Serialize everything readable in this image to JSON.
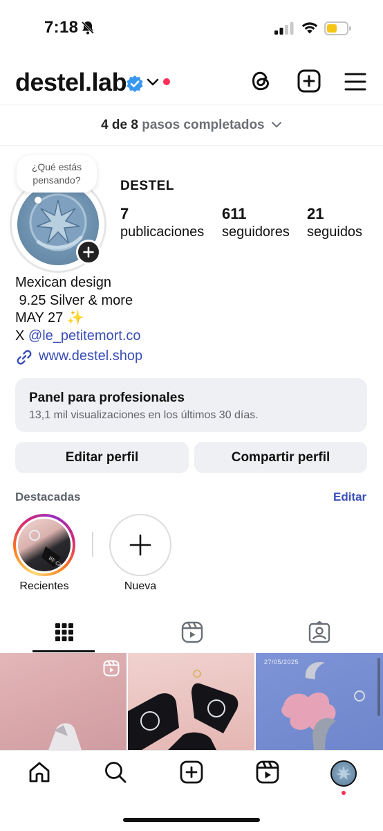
{
  "status_bar": {
    "time": "7:18",
    "battery_color": "#f5c518"
  },
  "header": {
    "username": "destel.lab",
    "icons": [
      "verified-badge-icon",
      "chevron-down-icon",
      "threads-icon",
      "create-post-icon",
      "menu-icon"
    ],
    "accent": "#3897f0"
  },
  "steps": {
    "progress": "4 de 8",
    "rest": "pasos completados",
    "completed": 4,
    "total": 8
  },
  "profile": {
    "bubble_text": "¿Qué estás pensando?",
    "display_name": "DESTEL",
    "stats": [
      {
        "value": "7",
        "label": "publicaciones"
      },
      {
        "value": "611",
        "label": "seguidores"
      },
      {
        "value": "21",
        "label": "seguidos"
      }
    ],
    "bio": {
      "line1": "Mexican design",
      "line2": " 9.25 Silver & more",
      "line3": "MAY 27 ",
      "line3_emoji": "✨",
      "line4_prefix": "X ",
      "line4_mention": "@le_petitemort.co"
    },
    "link": "www.destel.shop"
  },
  "panel": {
    "title": "Panel para profesionales",
    "subtitle": "13,1 mil visualizaciones en los últimos 30 días."
  },
  "buttons": {
    "edit": "Editar perfil",
    "share": "Compartir perfil"
  },
  "highlights": {
    "title": "Destacadas",
    "edit": "Editar",
    "items": [
      {
        "label": "Recientes"
      },
      {
        "label": "Nueva"
      }
    ]
  },
  "tabs": [
    "grid-icon",
    "reels-icon",
    "tagged-icon"
  ],
  "grid": {
    "post3_date": "27/05/2025"
  },
  "bottom_nav": [
    "home-icon",
    "search-icon",
    "create-icon",
    "reels-icon",
    "profile-avatar"
  ]
}
